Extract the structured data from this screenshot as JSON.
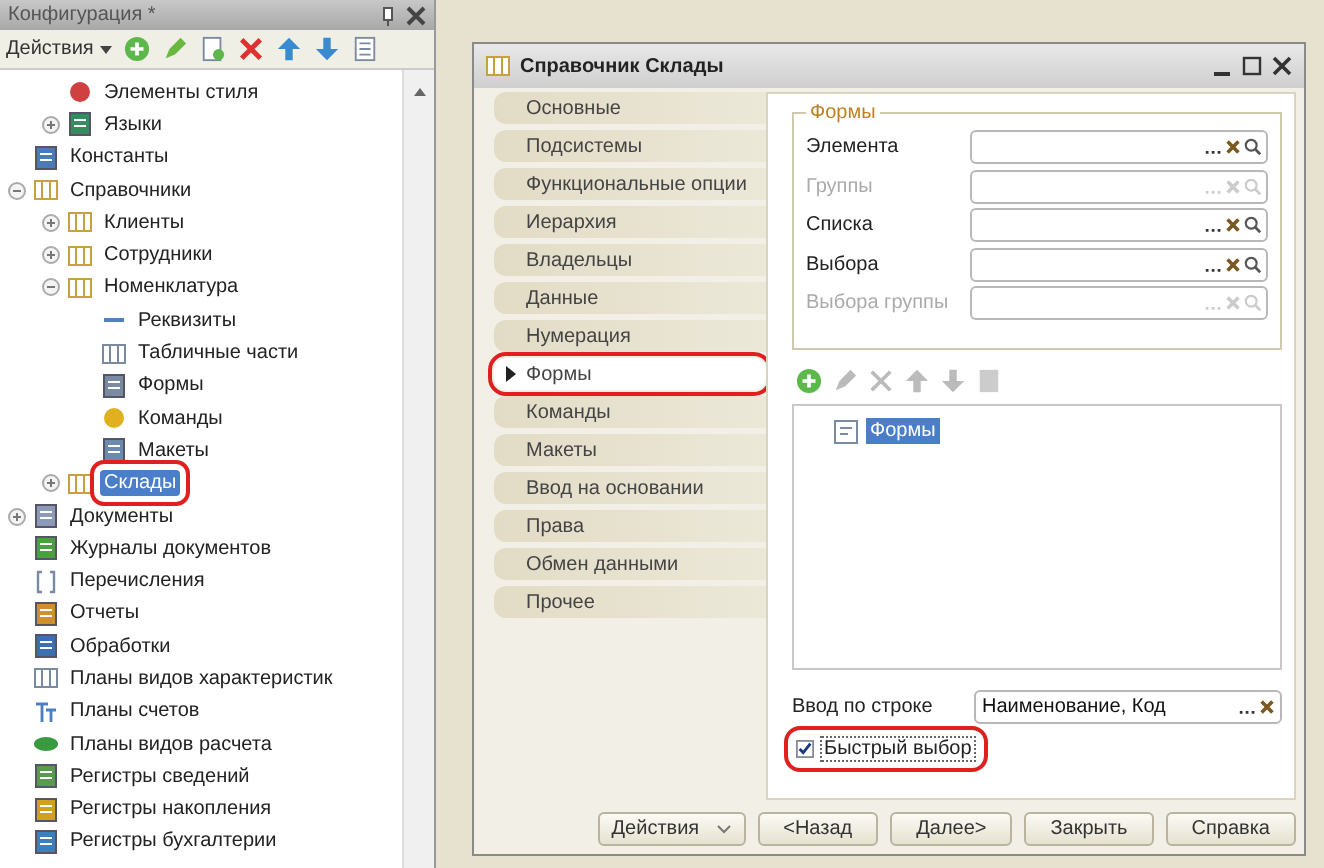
{
  "config_panel": {
    "title": "Конфигурация *",
    "toolbar_menu": "Действия",
    "tree": [
      {
        "children": [
          {
            "label": "Элементы стиля",
            "kind": "palette",
            "selected": false,
            "annotated": false
          },
          {
            "label": "Языки",
            "kind": "globe",
            "expanded": false,
            "selected": false,
            "annotated": false
          }
        ]
      },
      {
        "label": "Константы",
        "kind": "constants",
        "selected": false,
        "annotated": false
      },
      {
        "label": "Справочники",
        "kind": "catalog",
        "expanded": true,
        "selected": false,
        "annotated": false,
        "children": [
          {
            "label": "Клиенты",
            "kind": "catalog",
            "expanded": false,
            "selected": false,
            "annotated": false
          },
          {
            "label": "Сотрудники",
            "kind": "catalog",
            "expanded": false,
            "selected": false,
            "annotated": false
          },
          {
            "label": "Номенклатура",
            "kind": "catalog",
            "expanded": true,
            "selected": false,
            "annotated": false,
            "children": [
              {
                "label": "Реквизиты",
                "kind": "attribute",
                "selected": false,
                "annotated": false
              },
              {
                "label": "Табличные части",
                "kind": "tabular",
                "selected": false,
                "annotated": false
              },
              {
                "label": "Формы",
                "kind": "form",
                "selected": false,
                "annotated": false
              },
              {
                "label": "Команды",
                "kind": "command",
                "selected": false,
                "annotated": false
              },
              {
                "label": "Макеты",
                "kind": "template",
                "selected": false,
                "annotated": false
              }
            ]
          },
          {
            "label": "Склады",
            "kind": "catalog",
            "expanded": false,
            "selected": true,
            "annotated": true
          }
        ]
      },
      {
        "label": "Документы",
        "kind": "document",
        "expanded": false,
        "selected": false,
        "annotated": false
      },
      {
        "label": "Журналы документов",
        "kind": "journal",
        "selected": false,
        "annotated": false
      },
      {
        "label": "Перечисления",
        "kind": "enum",
        "selected": false,
        "annotated": false
      },
      {
        "label": "Отчеты",
        "kind": "report",
        "selected": false,
        "annotated": false
      },
      {
        "label": "Обработки",
        "kind": "processing",
        "selected": false,
        "annotated": false
      },
      {
        "label": "Планы видов характеристик",
        "kind": "chars",
        "selected": false,
        "annotated": false
      },
      {
        "label": "Планы счетов",
        "kind": "accounts",
        "selected": false,
        "annotated": false
      },
      {
        "label": "Планы видов расчета",
        "kind": "calc",
        "selected": false,
        "annotated": false
      },
      {
        "label": "Регистры сведений",
        "kind": "inforeg",
        "selected": false,
        "annotated": false
      },
      {
        "label": "Регистры накопления",
        "kind": "accumreg",
        "selected": false,
        "annotated": false
      },
      {
        "label": "Регистры бухгалтерии",
        "kind": "accreg",
        "selected": false,
        "annotated": false
      }
    ]
  },
  "dialog": {
    "title": "Справочник Склады",
    "tabs": [
      {
        "label": "Основные",
        "selected": false,
        "annotated": false
      },
      {
        "label": "Подсистемы",
        "selected": false,
        "annotated": false
      },
      {
        "label": "Функциональные опции",
        "selected": false,
        "annotated": false
      },
      {
        "label": "Иерархия",
        "selected": false,
        "annotated": false
      },
      {
        "label": "Владельцы",
        "selected": false,
        "annotated": false
      },
      {
        "label": "Данные",
        "selected": false,
        "annotated": false
      },
      {
        "label": "Нумерация",
        "selected": false,
        "annotated": false
      },
      {
        "label": "Формы",
        "selected": true,
        "annotated": true
      },
      {
        "label": "Команды",
        "selected": false,
        "annotated": false
      },
      {
        "label": "Макеты",
        "selected": false,
        "annotated": false
      },
      {
        "label": "Ввод на основании",
        "selected": false,
        "annotated": false
      },
      {
        "label": "Права",
        "selected": false,
        "annotated": false
      },
      {
        "label": "Обмен данными",
        "selected": false,
        "annotated": false
      },
      {
        "label": "Прочее",
        "selected": false,
        "annotated": false
      }
    ],
    "forms_group": {
      "title": "Формы",
      "fields": [
        {
          "label": "Элемента",
          "disabled": false
        },
        {
          "label": "Группы",
          "disabled": true
        },
        {
          "label": "Списка",
          "disabled": false
        },
        {
          "label": "Выбора",
          "disabled": false
        },
        {
          "label": "Выбора группы",
          "disabled": true
        }
      ]
    },
    "forms_list": [
      {
        "label": "Формы",
        "selected": true
      }
    ],
    "input_by_string": {
      "label": "Ввод по строке",
      "value": "Наименование, Код"
    },
    "quick_choice": {
      "label": "Быстрый выбор",
      "checked": true,
      "annotated": true
    },
    "buttons": [
      {
        "label": "Действия",
        "kind": "menu"
      },
      {
        "label": "<Назад",
        "kind": "plain"
      },
      {
        "label": "Далее>",
        "kind": "plain"
      },
      {
        "label": "Закрыть",
        "kind": "plain"
      },
      {
        "label": "Справка",
        "kind": "plain"
      }
    ]
  }
}
